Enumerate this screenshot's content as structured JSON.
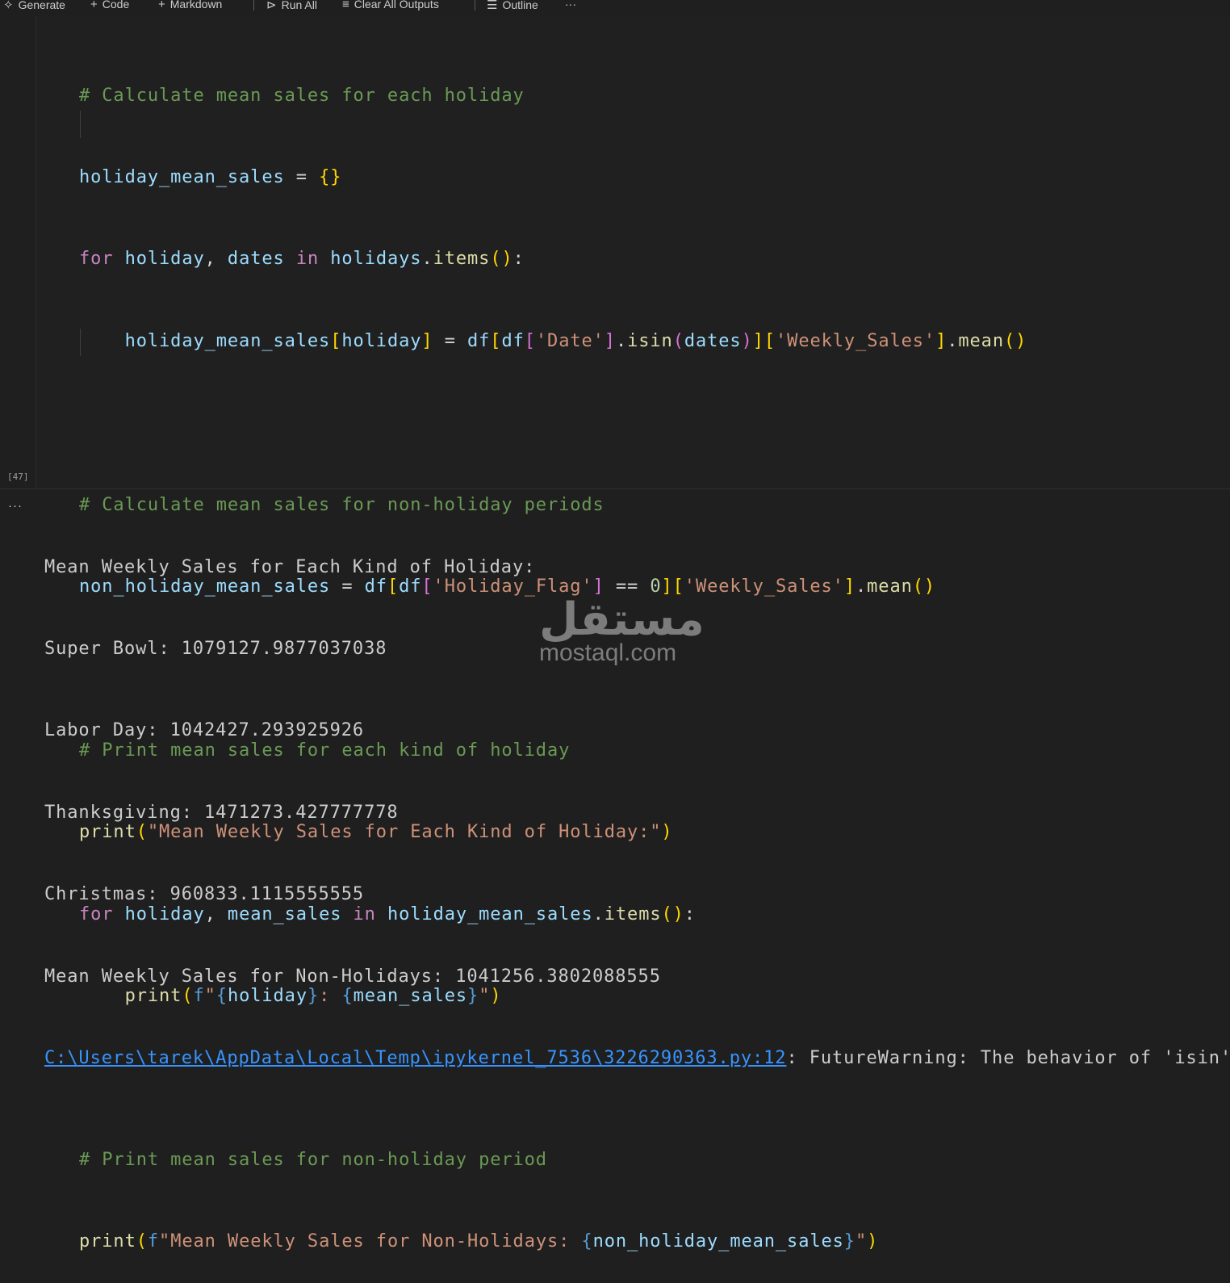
{
  "toolbar": {
    "generate": "Generate",
    "code": "Code",
    "markdown": "Markdown",
    "run_all": "Run All",
    "clear_outputs": "Clear All Outputs",
    "outline": "Outline",
    "more": "···"
  },
  "cell": {
    "execution_count": "[47]",
    "code_lines": [
      "# Calculate mean sales for each holiday",
      "holiday_mean_sales = {}",
      "for holiday, dates in holidays.items():",
      "    holiday_mean_sales[holiday] = df[df['Date'].isin(dates)]['Weekly_Sales'].mean()",
      "",
      "# Calculate mean sales for non-holiday periods",
      "non_holiday_mean_sales = df[df['Holiday_Flag'] == 0]['Weekly_Sales'].mean()",
      "",
      "# Print mean sales for each kind of holiday",
      "print(\"Mean Weekly Sales for Each Kind of Holiday:\")",
      "for holiday, mean_sales in holiday_mean_sales.items():",
      "    print(f\"{holiday}: {mean_sales}\")",
      "",
      "# Print mean sales for non-holiday period",
      "print(f\"Mean Weekly Sales for Non-Holidays: {non_holiday_mean_sales}\")"
    ]
  },
  "output": {
    "ellipsis": "···",
    "lines": [
      "Mean Weekly Sales for Each Kind of Holiday:",
      "Super Bowl: 1079127.9877037038",
      "Labor Day: 1042427.293925926",
      "Thanksgiving: 1471273.427777778",
      "Christmas: 960833.1115555555",
      "Mean Weekly Sales for Non-Holidays: 1041256.3802088555"
    ],
    "warning_link": "C:\\Users\\tarek\\AppData\\Local\\Temp\\ipykernel_7536\\3226290363.py:12",
    "warning_text": ": FutureWarning: The behavior of 'isin' wi"
  },
  "watermark": {
    "arabic": "مستقل",
    "latin": "mostaql.com"
  }
}
